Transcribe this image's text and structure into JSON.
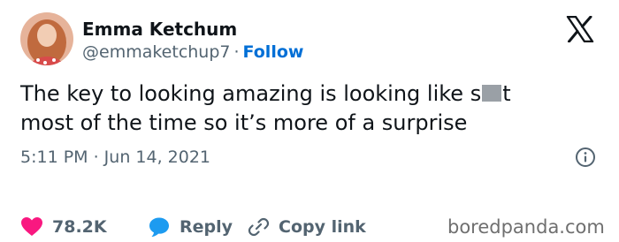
{
  "author": {
    "display_name": "Emma Ketchum",
    "handle": "@emmaketchup7",
    "separator": "·",
    "follow_label": "Follow"
  },
  "tweet": {
    "line1_before": "The key to looking amazing is looking like s",
    "line1_after": "t",
    "line2": "most of the time so it’s more of a surprise",
    "timestamp": "5:11 PM · Jun 14, 2021"
  },
  "actions": {
    "likes_count": "78.2K",
    "reply_label": "Reply",
    "copy_link_label": "Copy link"
  },
  "icons": {
    "brand": "x-logo-icon",
    "info": "info-icon",
    "like": "heart-icon",
    "reply": "speech-bubble-icon",
    "copy_link": "link-icon"
  },
  "watermark": "boredpanda.com",
  "colors": {
    "text": "#0f1419",
    "secondary": "#536471",
    "link": "#006fd6",
    "heart": "#f91880",
    "bubble": "#1d9bf0"
  }
}
